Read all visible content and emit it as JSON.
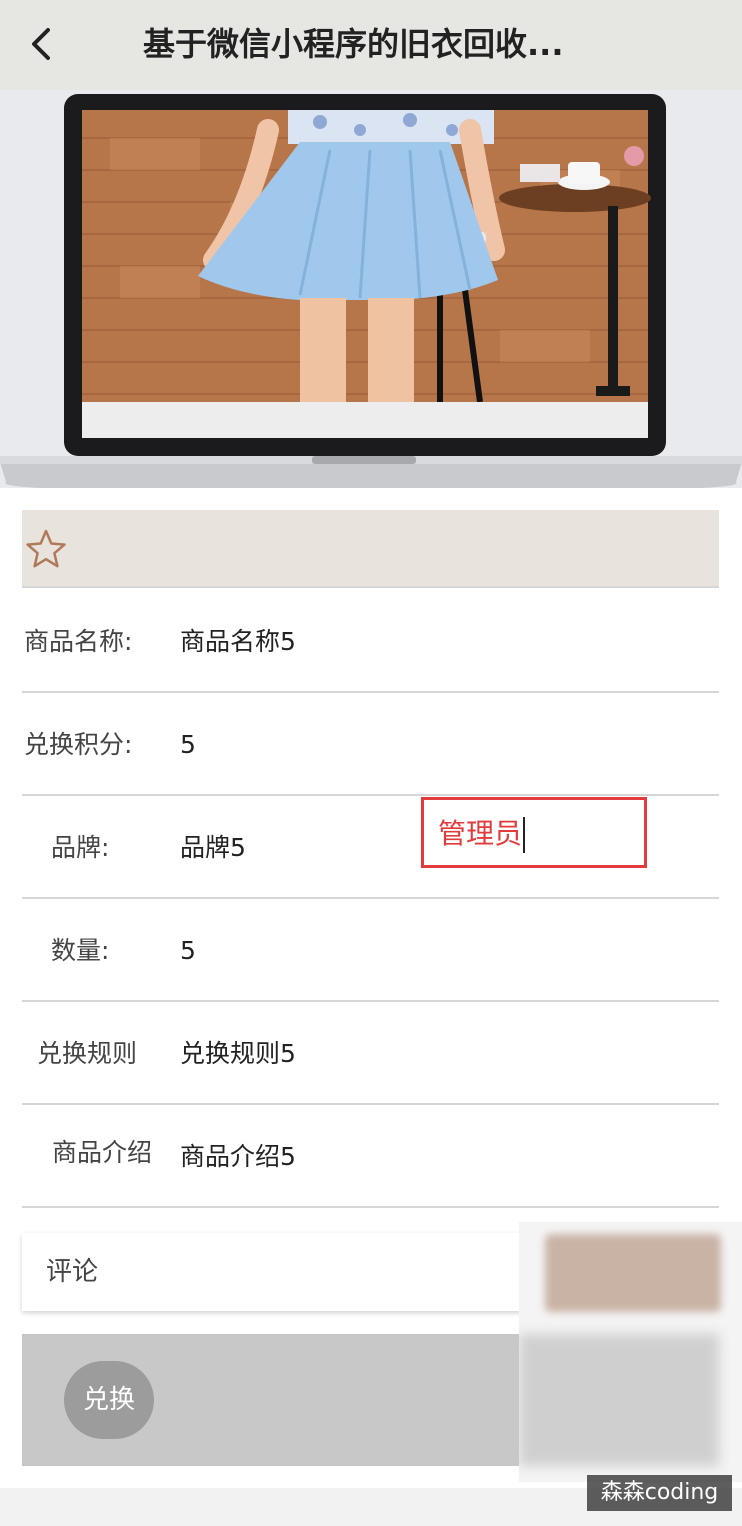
{
  "header": {
    "title": "基于微信小程序的旧衣回收..."
  },
  "details": {
    "rows": [
      {
        "label": "商品名称:",
        "value": "商品名称5"
      },
      {
        "label": "兑换积分:",
        "value": "5"
      },
      {
        "label": "品牌:",
        "value": "品牌5"
      },
      {
        "label": "数量:",
        "value": "5"
      },
      {
        "label": "兑换规则",
        "value": "兑换规则5"
      },
      {
        "label": "商品介绍",
        "value": "商品介绍5"
      }
    ]
  },
  "annotation": {
    "text": "管理员",
    "color": "#e23b3b"
  },
  "comment": {
    "label": "评论"
  },
  "actions": {
    "exchange_label": "兑换"
  },
  "watermark": {
    "text": "森森coding"
  },
  "colors": {
    "header_bg": "#e6e6e3",
    "fav_bar_bg": "#e8e3dd",
    "star_outline": "#b07a5a",
    "action_bg": "#c8c8c8"
  },
  "icons": {
    "back": "chevron-left-icon",
    "favorite": "star-outline-icon"
  }
}
